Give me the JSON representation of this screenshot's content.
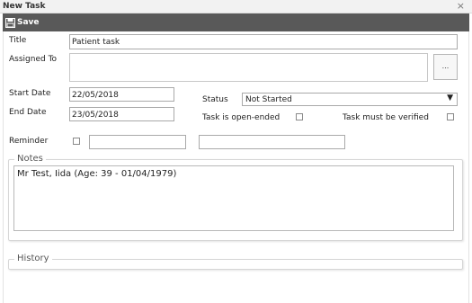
{
  "window": {
    "title": "New Task",
    "close_glyph": "×"
  },
  "toolbar": {
    "save_label": "Save",
    "save_icon": "floppy-disk-icon"
  },
  "form": {
    "title_label": "Title",
    "title_value": "Patient task",
    "assigned_to_label": "Assigned To",
    "assigned_to_value": "",
    "browse_button_label": "...",
    "start_date_label": "Start Date",
    "start_date_value": "22/05/2018",
    "end_date_label": "End Date",
    "end_date_value": "23/05/2018",
    "status_label": "Status",
    "status_value": "Not Started",
    "open_ended_label": "Task is open-ended",
    "open_ended_checked": false,
    "must_verify_label": "Task must be verified",
    "must_verify_checked": false,
    "reminder_label": "Reminder",
    "reminder_checked": false,
    "reminder_date_value": "",
    "reminder_time_value": ""
  },
  "notes": {
    "legend": "Notes",
    "text": "Mr Test, Iida  (Age: 39 - 01/04/1979)"
  },
  "history": {
    "legend": "History"
  }
}
